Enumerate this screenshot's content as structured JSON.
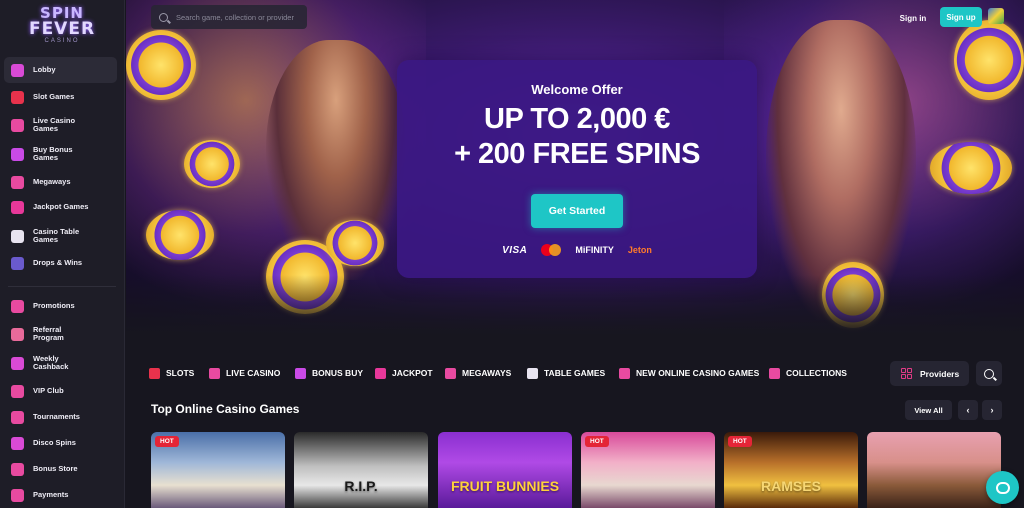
{
  "brand": {
    "line1": "SPIN",
    "line2": "FEVER",
    "sub": "CASINO"
  },
  "topbar": {
    "search_placeholder": "Search game, collection or provider",
    "signin": "Sign in",
    "signup": "Sign up"
  },
  "sidebar": {
    "items": [
      {
        "label": "Lobby",
        "icon": "lobby-icon",
        "color": "#d94ad6"
      },
      {
        "label": "Slot Games",
        "icon": "cherry-icon",
        "color": "#e8324c"
      },
      {
        "label": "Live Casino\nGames",
        "icon": "live-casino-icon",
        "color": "#e84aa0"
      },
      {
        "label": "Buy Bonus\nGames",
        "icon": "money-bag-icon",
        "color": "#c94ae6"
      },
      {
        "label": "Megaways",
        "icon": "megaways-icon",
        "color": "#e84aa0"
      },
      {
        "label": "Jackpot Games",
        "icon": "diamond-icon",
        "color": "#e8389a"
      },
      {
        "label": "Casino Table\nGames",
        "icon": "cards-icon",
        "color": "#e8e4f0"
      },
      {
        "label": "Drops & Wins",
        "icon": "drops-wins-icon",
        "color": "#6a5acd"
      },
      {
        "label": "Promotions",
        "icon": "gift-icon",
        "color": "#e84aa0"
      },
      {
        "label": "Referral\nProgram",
        "icon": "referral-icon",
        "color": "#e86a9a"
      },
      {
        "label": "Weekly\nCashback",
        "icon": "cashback-icon",
        "color": "#d94ad6"
      },
      {
        "label": "VIP Club",
        "icon": "crown-icon",
        "color": "#e84aa0"
      },
      {
        "label": "Tournaments",
        "icon": "trophy-icon",
        "color": "#e84aa0"
      },
      {
        "label": "Disco Spins",
        "icon": "disco-ball-icon",
        "color": "#d94ad6"
      },
      {
        "label": "Bonus Store",
        "icon": "store-icon",
        "color": "#e84aa0"
      },
      {
        "label": "Payments",
        "icon": "wallet-icon",
        "color": "#e84aa0"
      }
    ]
  },
  "hero": {
    "kicker": "Welcome Offer",
    "line1": "UP TO 2,000 €",
    "line2": "+ 200 FREE SPINS",
    "cta": "Get Started",
    "payments": [
      "VISA",
      "mastercard",
      "MiFINITY",
      "Jeton"
    ]
  },
  "categories": [
    {
      "label": "SLOTS",
      "icon": "cherry-icon",
      "color": "#e8324c"
    },
    {
      "label": "LIVE CASINO",
      "icon": "live-casino-icon",
      "color": "#e84aa0"
    },
    {
      "label": "BONUS BUY",
      "icon": "money-bag-icon",
      "color": "#c94ae6"
    },
    {
      "label": "JACKPOT",
      "icon": "diamond-icon",
      "color": "#e8389a"
    },
    {
      "label": "MEGAWAYS",
      "icon": "megaways-icon",
      "color": "#e84aa0"
    },
    {
      "label": "TABLE GAMES",
      "icon": "cards-icon",
      "color": "#e8e4f0"
    },
    {
      "label": "NEW ONLINE CASINO GAMES",
      "icon": "lightning-icon",
      "color": "#e84aa0"
    },
    {
      "label": "COLLECTIONS",
      "icon": "collections-icon",
      "color": "#e84aa0"
    }
  ],
  "providers_label": "Providers",
  "section": {
    "title": "Top Online Casino Games",
    "view_all": "View All",
    "prev": "‹",
    "next": "›"
  },
  "games": [
    {
      "badge": "HOT",
      "art_text": ""
    },
    {
      "badge": "",
      "art_text": "R.I.P."
    },
    {
      "badge": "",
      "art_text": "FRUIT BUNNIES"
    },
    {
      "badge": "HOT",
      "art_text": ""
    },
    {
      "badge": "HOT",
      "art_text": "RAMSES"
    },
    {
      "badge": "",
      "art_text": ""
    }
  ]
}
